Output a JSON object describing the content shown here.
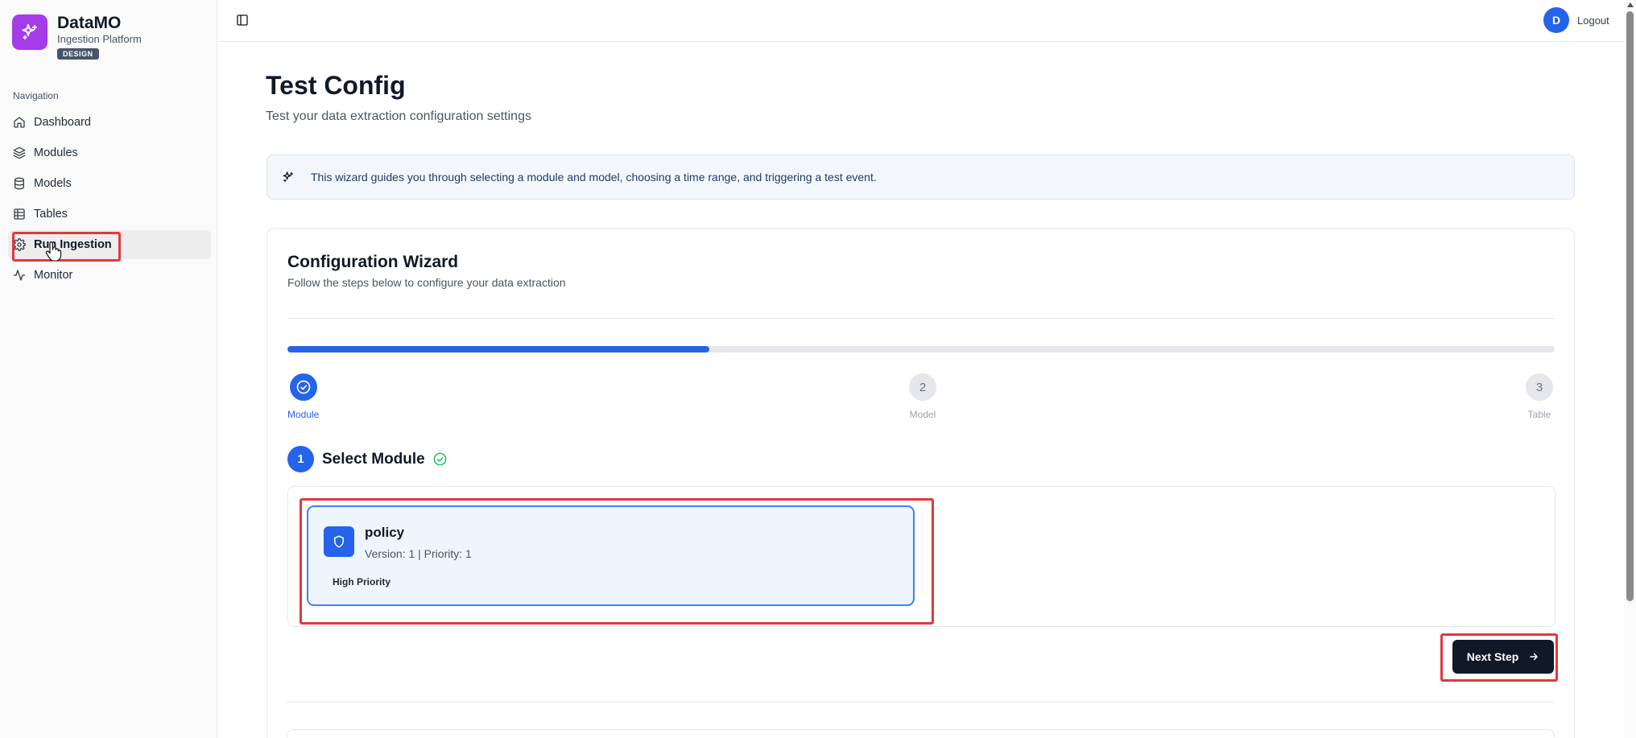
{
  "app": {
    "name": "DataMO",
    "subtitle": "Ingestion Platform",
    "badge": "DESIGN",
    "brand_color": "#a43ce9"
  },
  "sidebar": {
    "section_label": "Navigation",
    "items": [
      {
        "label": "Dashboard",
        "icon": "home-icon"
      },
      {
        "label": "Modules",
        "icon": "layers-icon"
      },
      {
        "label": "Models",
        "icon": "database-icon"
      },
      {
        "label": "Tables",
        "icon": "table-icon"
      },
      {
        "label": "Run Ingestion",
        "icon": "gear-icon",
        "active": true
      },
      {
        "label": "Monitor",
        "icon": "activity-icon"
      }
    ]
  },
  "topbar": {
    "avatar_initial": "D",
    "logout_label": "Logout"
  },
  "page": {
    "title": "Test Config",
    "subtitle": "Test your data extraction configuration settings",
    "info": "This wizard guides you through selecting a module and model, choosing a time range, and triggering a test event."
  },
  "wizard": {
    "title": "Configuration Wizard",
    "subtitle": "Follow the steps below to configure your data extraction",
    "progress_percent": 33.3,
    "steps": [
      {
        "number": "1",
        "label": "Module",
        "status": "complete"
      },
      {
        "number": "2",
        "label": "Model",
        "status": "pending"
      },
      {
        "number": "3",
        "label": "Table",
        "status": "pending"
      }
    ],
    "current_section": {
      "number": "1",
      "title": "Select Module"
    },
    "module": {
      "name": "policy",
      "meta": "Version: 1 | Priority: 1",
      "priority_label": "High Priority",
      "icon": "shield-icon"
    },
    "next_button": "Next Step"
  },
  "colors": {
    "accent": "#2563eb",
    "highlight": "#e0383e",
    "success": "#22c55e"
  }
}
